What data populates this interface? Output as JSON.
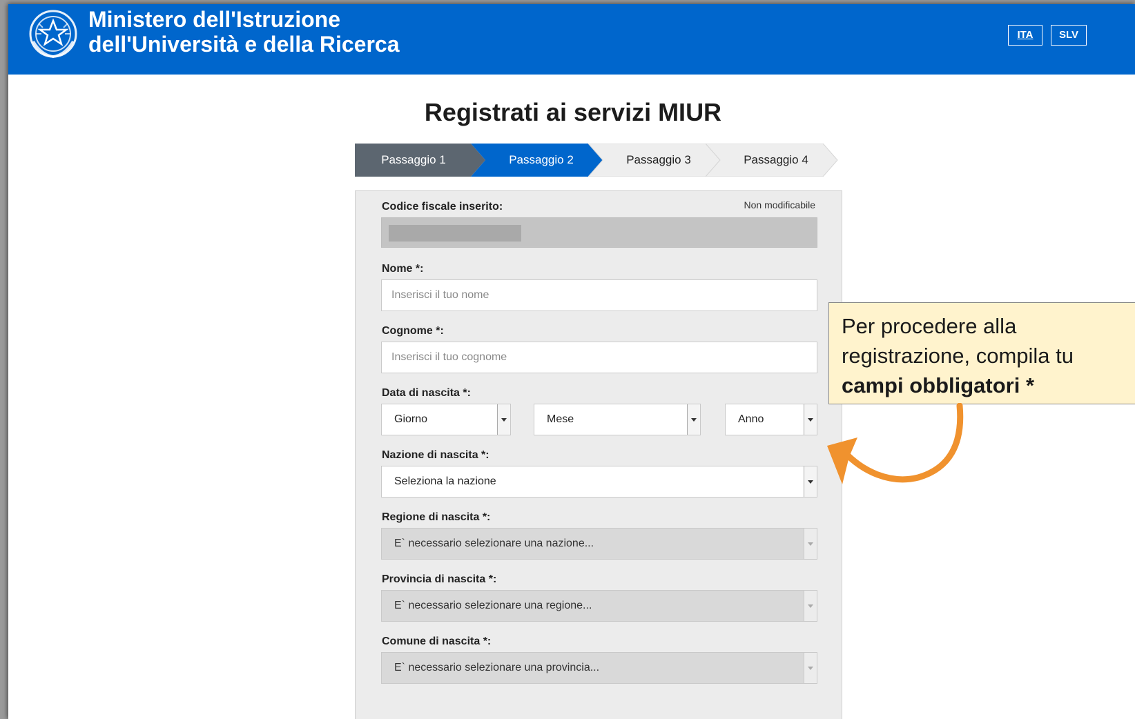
{
  "header": {
    "title_line1": "Ministero dell'Istruzione",
    "title_line2": "dell'Università e della Ricerca",
    "languages": [
      "ITA",
      "SLV"
    ],
    "colors": {
      "bar": "#0066cc"
    }
  },
  "page": {
    "title": "Registrati ai servizi MIUR"
  },
  "stepper": {
    "steps": [
      {
        "label": "Passaggio 1",
        "state": "completed"
      },
      {
        "label": "Passaggio 2",
        "state": "active"
      },
      {
        "label": "Passaggio 3",
        "state": "pending"
      },
      {
        "label": "Passaggio 4",
        "state": "pending"
      }
    ],
    "colors": {
      "completed": "#5c6670",
      "active": "#0066cc",
      "pending": "#eeeeee"
    }
  },
  "form": {
    "codice_fiscale": {
      "label": "Codice fiscale inserito:",
      "note": "Non modificabile"
    },
    "nome": {
      "label": "Nome *:",
      "placeholder": "Inserisci il tuo nome"
    },
    "cognome": {
      "label": "Cognome *:",
      "placeholder": "Inserisci il tuo cognome"
    },
    "data_nascita": {
      "label": "Data di nascita *:",
      "giorno": "Giorno",
      "mese": "Mese",
      "anno": "Anno"
    },
    "nazione": {
      "label": "Nazione di nascita *:",
      "value": "Seleziona la nazione"
    },
    "regione": {
      "label": "Regione di nascita *:",
      "value": "E` necessario selezionare una nazione..."
    },
    "provincia": {
      "label": "Provincia di nascita *:",
      "value": "E` necessario selezionare una regione..."
    },
    "comune": {
      "label": "Comune di nascita *:",
      "value": "E` necessario selezionare una provincia..."
    }
  },
  "callout": {
    "line1": "Per procedere alla",
    "line2": "registrazione, compila tu",
    "line3": "campi obbligatori *",
    "colors": {
      "background": "#fff3cd",
      "arrow": "#f0922e"
    }
  }
}
